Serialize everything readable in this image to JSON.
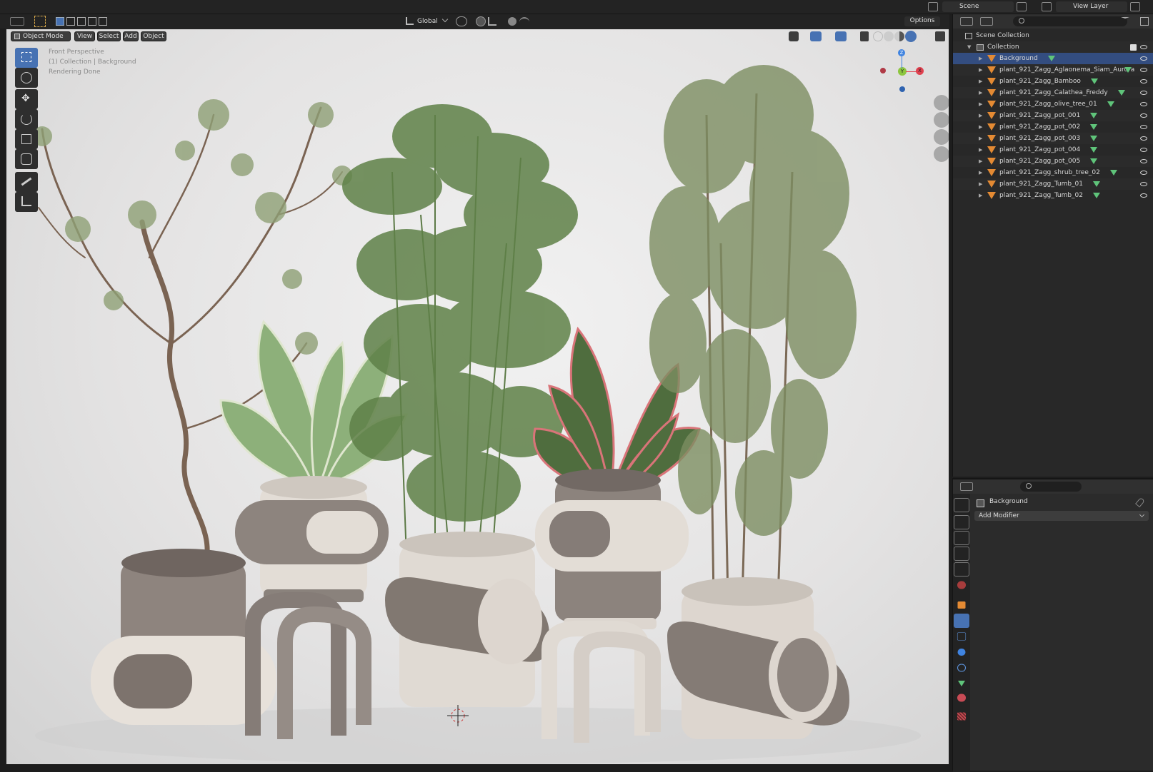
{
  "topbar": {
    "scene_label": "Scene",
    "view_layer_label": "View Layer"
  },
  "viewport_header": {
    "transform_orientation": "Global",
    "options_label": "Options"
  },
  "viewport_menu": {
    "mode": "Object Mode",
    "view": "View",
    "select": "Select",
    "add": "Add",
    "object": "Object"
  },
  "viewport_info": {
    "line1": "Front Perspective",
    "line2": "(1) Collection | Background",
    "line3": "Rendering Done"
  },
  "gizmo": {
    "z": "Z",
    "y": "Y",
    "x": "X"
  },
  "outliner": {
    "scene_collection": "Scene Collection",
    "collection": "Collection",
    "items": [
      {
        "label": "Background",
        "selected": true
      },
      {
        "label": "plant_921_Zagg_Aglaonema_Siam_Aurora",
        "selected": false
      },
      {
        "label": "plant_921_Zagg_Bamboo",
        "selected": false
      },
      {
        "label": "plant_921_Zagg_Calathea_Freddy",
        "selected": false
      },
      {
        "label": "plant_921_Zagg_olive_tree_01",
        "selected": false
      },
      {
        "label": "plant_921_Zagg_pot_001",
        "selected": false
      },
      {
        "label": "plant_921_Zagg_pot_002",
        "selected": false
      },
      {
        "label": "plant_921_Zagg_pot_003",
        "selected": false
      },
      {
        "label": "plant_921_Zagg_pot_004",
        "selected": false
      },
      {
        "label": "plant_921_Zagg_pot_005",
        "selected": false
      },
      {
        "label": "plant_921_Zagg_shrub_tree_02",
        "selected": false
      },
      {
        "label": "plant_921_Zagg_Tumb_01",
        "selected": false
      },
      {
        "label": "plant_921_Zagg_Tumb_02",
        "selected": false
      }
    ]
  },
  "properties": {
    "object_name": "Background",
    "add_modifier": "Add Modifier"
  },
  "colors": {
    "accent": "#4772b3",
    "selection": "#334d80",
    "mesh_orange": "#e48a33",
    "mesh_data_green": "#5fc47a",
    "axis_x": "#e0414f",
    "axis_y": "#8cc63e",
    "axis_z": "#3f83e0"
  }
}
